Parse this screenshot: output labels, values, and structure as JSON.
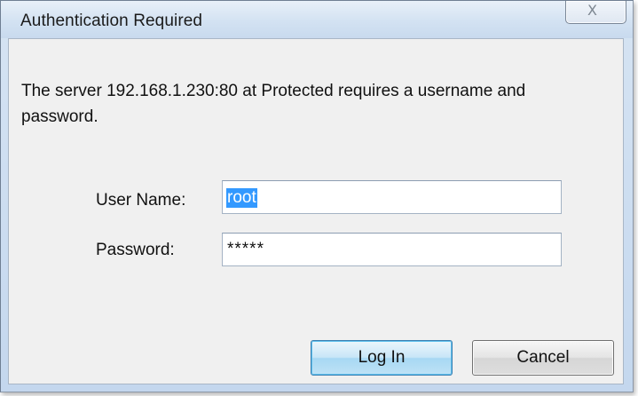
{
  "dialog": {
    "title": "Authentication Required",
    "close_glyph": "X",
    "message": "The server 192.168.1.230:80 at Protected requires a username and password.",
    "username": {
      "label": "User Name:",
      "value": "root"
    },
    "password": {
      "label": "Password:",
      "value": "*****"
    },
    "buttons": {
      "login_label": "Log In",
      "cancel_label": "Cancel"
    }
  },
  "icons": {
    "close": "close-icon"
  },
  "colors": {
    "selection_highlight": "#3399ff",
    "default_button_border": "#3c7fb1",
    "title_bar": "#d3e2f2",
    "client_area": "#f0f0f0"
  }
}
